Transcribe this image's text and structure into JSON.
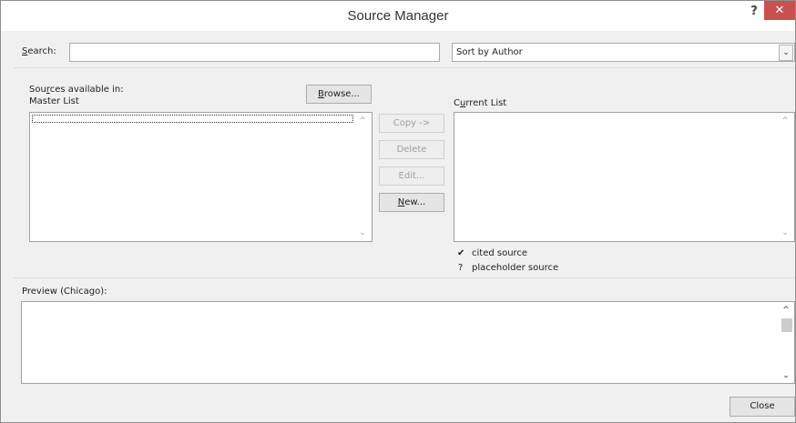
{
  "window": {
    "title": "Source Manager",
    "help_glyph": "?",
    "close_glyph": "✕"
  },
  "search": {
    "label_prefix": "",
    "label_key": "S",
    "label_rest": "earch:",
    "value": ""
  },
  "sort": {
    "selected": "Sort by Author",
    "arrow": "⌄"
  },
  "sources": {
    "label_line1_pre": "Sou",
    "label_line1_key": "r",
    "label_line1_post": "ces available in:",
    "label_line2": "Master List",
    "browse_key": "B",
    "browse_rest": "rowse...",
    "current_pre": "C",
    "current_key": "u",
    "current_post": "rrent List"
  },
  "actions": {
    "copy": "Copy ->",
    "delete": "Delete",
    "edit": "Edit...",
    "new_key": "N",
    "new_rest": "ew..."
  },
  "legend": [
    {
      "symbol": "✔",
      "text": "cited source"
    },
    {
      "symbol": "?",
      "text": "placeholder source"
    }
  ],
  "preview": {
    "label": "Preview (Chicago):"
  },
  "footer": {
    "close_label": "Close"
  },
  "scroll": {
    "up": "^",
    "down": "⌄"
  }
}
